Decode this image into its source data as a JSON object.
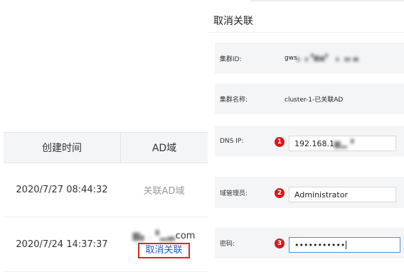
{
  "table": {
    "headers": {
      "created_time": "创建时间",
      "ad_domain": "AD域"
    },
    "rows": [
      {
        "created_time": "2020/7/27 08:44:32",
        "ad_action": "关联AD域"
      },
      {
        "created_time": "2020/7/24 14:37:37",
        "ad_domain_masked": "▆▖.▝▂▃",
        "ad_domain_suffix": "com",
        "ad_action": "取消关联"
      }
    ]
  },
  "drawer": {
    "title": "取消关联",
    "fields": {
      "cluster_id": {
        "label": "集群ID:",
        "value_prefix": "gws",
        "value_masked": "▖▗▝▆▅▘ ▗ ▗▖▄"
      },
      "cluster_name": {
        "label": "集群名称:",
        "value": "cluster-1-已关联AD"
      },
      "dns_ip": {
        "label": "DNS IP:",
        "value_prefix": "192.168.1",
        "value_masked": "▆▂▝",
        "badge": "1"
      },
      "domain_admin": {
        "label": "域管理员:",
        "value": "Administrator",
        "badge": "2"
      },
      "password": {
        "label": "密码:",
        "value": "•••••••••••",
        "badge": "3"
      }
    }
  },
  "colors": {
    "link_blue": "#1a5dc7",
    "highlight_red": "#d9262b",
    "badge_red": "#d6181c",
    "focus_blue": "#4a90d9"
  }
}
